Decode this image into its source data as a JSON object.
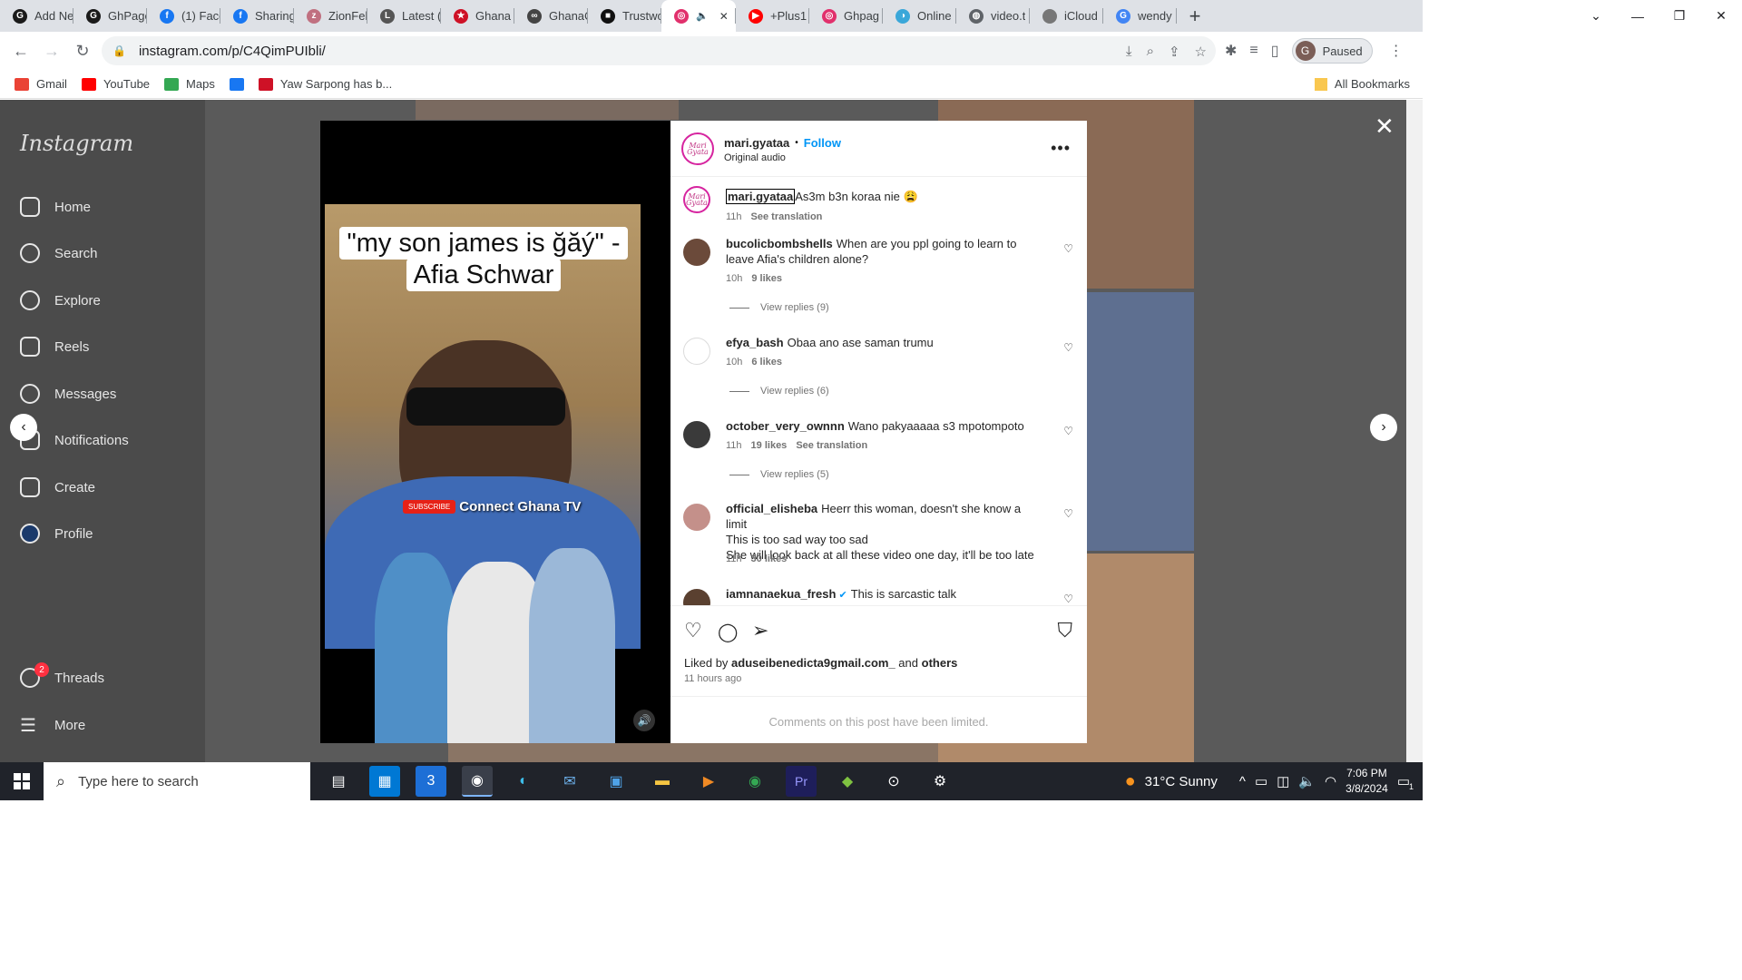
{
  "browser": {
    "tabs": [
      {
        "label": "Add Ne",
        "color": "#1a1a1a",
        "glyph": "G"
      },
      {
        "label": "GhPage",
        "color": "#1a1a1a",
        "glyph": "G"
      },
      {
        "label": "(1) Face",
        "color": "#1877f2",
        "glyph": "f"
      },
      {
        "label": "Sharing",
        "color": "#1877f2",
        "glyph": "f"
      },
      {
        "label": "ZionFel",
        "color": "#c07080",
        "glyph": "z"
      },
      {
        "label": "Latest (",
        "color": "#555555",
        "glyph": "L"
      },
      {
        "label": "Ghana",
        "color": "#ce1126",
        "glyph": "★"
      },
      {
        "label": "GhanaC",
        "color": "#444444",
        "glyph": "∞"
      },
      {
        "label": "Trustwc",
        "color": "#111111",
        "glyph": "■"
      },
      {
        "label": "",
        "color": "#e1306c",
        "glyph": "◎",
        "active": true
      },
      {
        "label": "+Plus1",
        "color": "#ff0000",
        "glyph": "▶"
      },
      {
        "label": "Ghpag",
        "color": "#e1306c",
        "glyph": "◎"
      },
      {
        "label": "Online",
        "color": "#3aa7d9",
        "glyph": "◑"
      },
      {
        "label": "video.t",
        "color": "#5f6368",
        "glyph": "◍"
      },
      {
        "label": "iCloud",
        "color": "#777777",
        "glyph": ""
      },
      {
        "label": "wendy",
        "color": "#4285f4",
        "glyph": "G"
      }
    ],
    "new_tab": "+",
    "window_controls": {
      "minimize": "—",
      "maximize": "❐",
      "close": "✕"
    },
    "url": "instagram.com/p/C4QimPUIbli/",
    "profile_status": "Paused",
    "profile_initial": "G",
    "bookmarks": [
      {
        "label": "Gmail",
        "color": "#ea4335"
      },
      {
        "label": "YouTube",
        "color": "#ff0000"
      },
      {
        "label": "Maps",
        "color": "#34a853"
      },
      {
        "label": "",
        "color": "#1877f2"
      },
      {
        "label": "Yaw Sarpong has b...",
        "color": "#ce1126"
      }
    ],
    "all_bookmarks": "All Bookmarks"
  },
  "sidebar": {
    "logo": "Instagram",
    "items": [
      {
        "label": "Home",
        "icon": "home-icon"
      },
      {
        "label": "Search",
        "icon": "search-icon"
      },
      {
        "label": "Explore",
        "icon": "explore-icon"
      },
      {
        "label": "Reels",
        "icon": "reels-icon"
      },
      {
        "label": "Messages",
        "icon": "messages-icon"
      },
      {
        "label": "Notifications",
        "icon": "heart-icon"
      },
      {
        "label": "Create",
        "icon": "plus-square-icon"
      },
      {
        "label": "Profile",
        "icon": "profile-avatar-icon"
      }
    ],
    "threads_label": "Threads",
    "threads_badge": "2",
    "more_label": "More"
  },
  "post": {
    "video_caption": "\"my son james is ğăý\" - Afia Schwar",
    "video_subscribe": "SUBSCRIBE",
    "video_channel": "Connect Ghana TV",
    "author": "mari.gyataa",
    "author_avatar_text": "Mari Gyata",
    "follow_label": "Follow",
    "dot": "•",
    "audio": "Original audio",
    "caption_user": "mari.gyataa",
    "caption_text": "As3m b3n koraa nie 😩",
    "caption_time": "11h",
    "see_translation": "See translation",
    "comments": [
      {
        "user": "bucolicbombshells",
        "text": "When are you ppl going to learn to leave Afia's children alone?",
        "time": "10h",
        "likes": "9 likes",
        "translation": "",
        "replies": "View replies (9)",
        "verified": false
      },
      {
        "user": "efya_bash",
        "text": "Obaa ano ase saman trumu",
        "time": "10h",
        "likes": "6 likes",
        "translation": "",
        "replies": "View replies (6)",
        "verified": false
      },
      {
        "user": "october_very_ownnn",
        "text": "Wano pakyaaaaa s3 mpotompoto",
        "time": "11h",
        "likes": "19 likes",
        "translation": "See translation",
        "replies": "View replies (5)",
        "verified": false
      },
      {
        "user": "official_elisheba",
        "text": "Heerr this woman, doesn't she know a limit",
        "text2": "This is too sad way too sad",
        "text3": "She will look back at all these video one day, it'll be too late",
        "time": "11h",
        "likes": "30 likes",
        "translation": "",
        "replies": "",
        "verified": false
      },
      {
        "user": "iamnanaekua_fresh",
        "text": "This is sarcastic talk",
        "time": "",
        "likes": "",
        "translation": "",
        "replies": "",
        "verified": true
      }
    ],
    "liked_by_prefix": "Liked by",
    "liked_by_user": "aduseibenedicta9gmail.com_",
    "liked_by_and": "and",
    "liked_by_others": "others",
    "posted_ago": "11 hours ago",
    "comments_limited": "Comments on this post have been limited."
  },
  "taskbar": {
    "search_placeholder": "Type here to search",
    "weather": "31°C  Sunny",
    "time": "7:06 PM",
    "date": "3/8/2024",
    "notification_count": "1"
  }
}
